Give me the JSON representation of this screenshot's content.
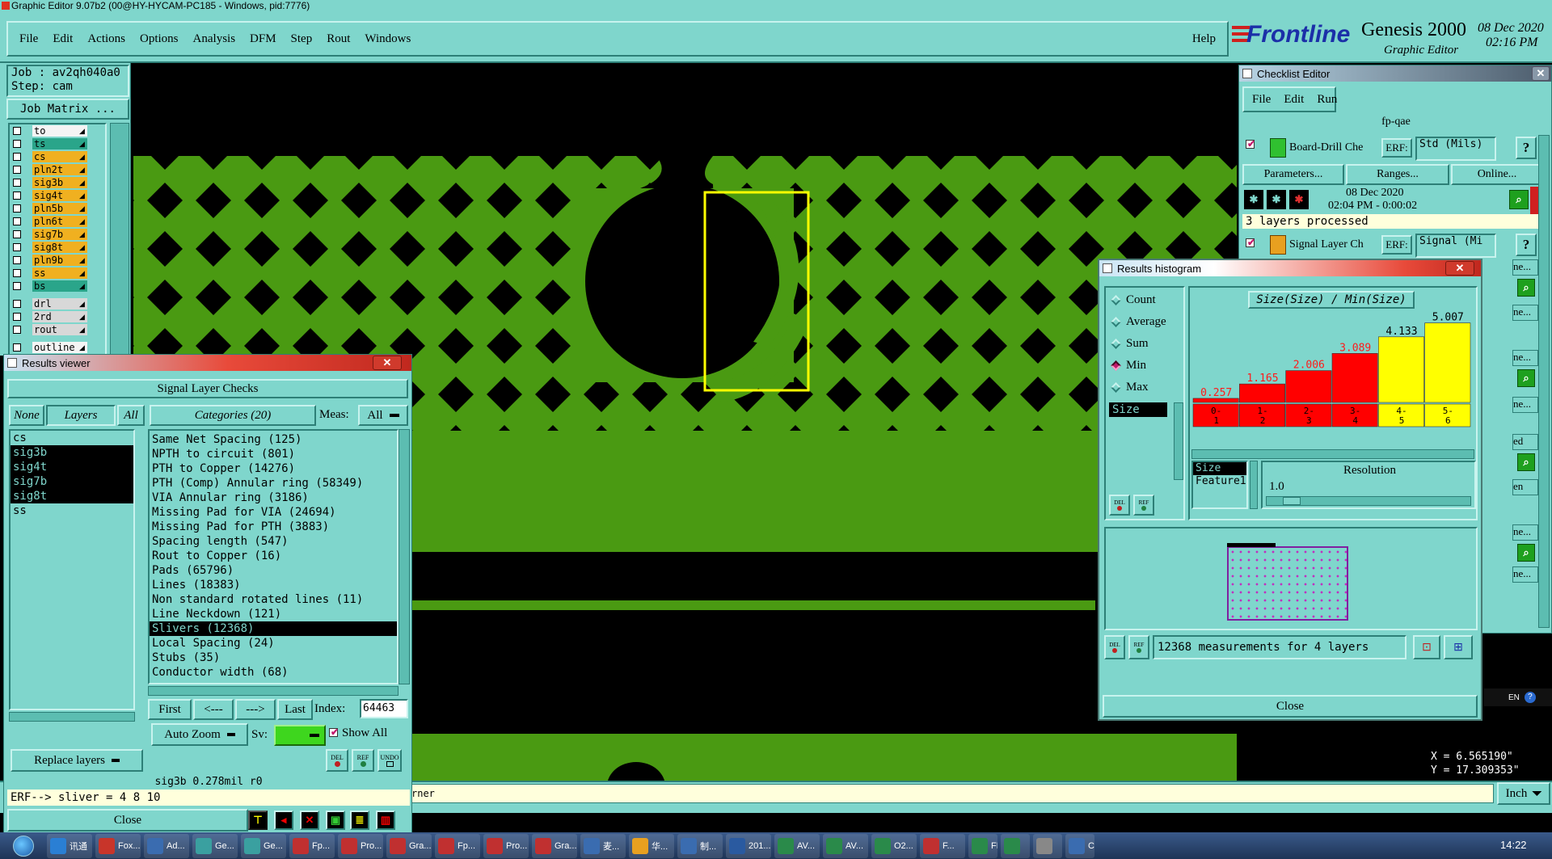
{
  "window_title": "Graphic Editor 9.07b2 (00@HY-HYCAM-PC185 - Windows, pid:7776)",
  "menu": {
    "items": [
      "File",
      "Edit",
      "Actions",
      "Options",
      "Analysis",
      "DFM",
      "Step",
      "Rout",
      "Windows"
    ],
    "help": "Help"
  },
  "brand": {
    "logo": "Frontline",
    "product": "Genesis 2000",
    "subtitle": "Graphic Editor",
    "date": "08 Dec 2020",
    "time": "02:16 PM"
  },
  "job": {
    "job_label": "Job : av2qh040a0",
    "step_label": "Step: cam",
    "matrix_button": "Job Matrix ..."
  },
  "layers": [
    {
      "name": "to",
      "color": "#f4f4f4"
    },
    {
      "name": "ts",
      "color": "#2aa58a"
    },
    {
      "name": "cs",
      "color": "#f0b020"
    },
    {
      "name": "pln2t",
      "color": "#f0b020"
    },
    {
      "name": "sig3b",
      "color": "#f0b020"
    },
    {
      "name": "sig4t",
      "color": "#f0b020"
    },
    {
      "name": "pln5b",
      "color": "#f0b020"
    },
    {
      "name": "pln6t",
      "color": "#f0b020"
    },
    {
      "name": "sig7b",
      "color": "#f0b020"
    },
    {
      "name": "sig8t",
      "color": "#f0b020"
    },
    {
      "name": "pln9b",
      "color": "#f0b020"
    },
    {
      "name": "ss",
      "color": "#f0b020"
    },
    {
      "name": "bs",
      "color": "#2aa58a"
    },
    {
      "name": "drl",
      "color": "#d8d8d8"
    },
    {
      "name": "2rd",
      "color": "#d8d8d8"
    },
    {
      "name": "rout",
      "color": "#d8d8d8"
    },
    {
      "name": "outline",
      "color": "#f4f4f4"
    }
  ],
  "results_viewer": {
    "title": "Results viewer",
    "header": "Signal Layer Checks",
    "btn_none": "None",
    "btn_layers": "Layers",
    "btn_all": "All",
    "categories_label": "Categories (20)",
    "meas_label": "Meas:",
    "meas_value": "All",
    "layer_list": [
      {
        "name": "cs",
        "sel": false
      },
      {
        "name": "sig3b",
        "sel": true
      },
      {
        "name": "sig4t",
        "sel": true
      },
      {
        "name": "sig7b",
        "sel": true
      },
      {
        "name": "sig8t",
        "sel": true
      },
      {
        "name": "ss",
        "sel": false
      }
    ],
    "categories": [
      {
        "text": "Same Net Spacing (125)",
        "sel": false
      },
      {
        "text": "NPTH to circuit (801)",
        "sel": false
      },
      {
        "text": "PTH to Copper (14276)",
        "sel": false
      },
      {
        "text": "PTH (Comp) Annular ring (58349)",
        "sel": false
      },
      {
        "text": "VIA Annular ring (3186)",
        "sel": false
      },
      {
        "text": "Missing Pad for VIA (24694)",
        "sel": false
      },
      {
        "text": "Missing Pad for PTH (3883)",
        "sel": false
      },
      {
        "text": "Spacing length (547)",
        "sel": false
      },
      {
        "text": "Rout to Copper (16)",
        "sel": false
      },
      {
        "text": "Pads (65796)",
        "sel": false
      },
      {
        "text": "Lines (18383)",
        "sel": false
      },
      {
        "text": "Non standard rotated lines (11)",
        "sel": false
      },
      {
        "text": "Line Neckdown (121)",
        "sel": false
      },
      {
        "text": "Slivers (12368)",
        "sel": true
      },
      {
        "text": "Local Spacing (24)",
        "sel": false
      },
      {
        "text": "Stubs (35)",
        "sel": false
      },
      {
        "text": "Conductor width (68)",
        "sel": false
      }
    ],
    "nav": {
      "first": "First",
      "prev": "<---",
      "next": "--->",
      "last": "Last",
      "index_label": "Index:",
      "index_value": "64463"
    },
    "auto_zoom": "Auto Zoom",
    "sv_label": "Sv:",
    "show_all": "Show All",
    "replace_layers": "Replace layers",
    "del": "DEL",
    "ref": "REF",
    "undo": "UNDO",
    "status": "sig3b 0.278mil  r0",
    "erf": "ERF--> sliver = 4 8 10",
    "close": "Close"
  },
  "checklist": {
    "title": "Checklist Editor",
    "menu": [
      "File",
      "Edit",
      "Run"
    ],
    "name": "fp-qae",
    "check1": {
      "name": "Board-Drill Che",
      "erf_label": "ERF:",
      "erf_value": "Std (Mils)",
      "parameters": "Parameters...",
      "ranges": "Ranges...",
      "online": "Online...",
      "date": "08 Dec 2020",
      "time": "02:04 PM - 0:00:02",
      "status": "3 layers processed"
    },
    "check2": {
      "name": "Signal Layer Ch",
      "erf_label": "ERF:",
      "erf_value": "Signal (Mi"
    },
    "q": "?",
    "right_labels": [
      "ne...",
      "ne...",
      "ne...",
      "ne...",
      "ed",
      "en",
      "ne...",
      "ne..."
    ]
  },
  "histogram": {
    "title": "Results histogram",
    "modes": [
      {
        "label": "Count",
        "on": false
      },
      {
        "label": "Average",
        "on": false
      },
      {
        "label": "Sum",
        "on": false
      },
      {
        "label": "Min",
        "on": true
      },
      {
        "label": "Max",
        "on": false
      }
    ],
    "size_item": "Size",
    "chart_title": "Size(Size) / Min(Size)",
    "attr_list": [
      {
        "text": "Size",
        "sel": true
      },
      {
        "text": "Feature1",
        "sel": false
      }
    ],
    "resolution_label": "Resolution",
    "resolution_value": "1.0",
    "measurements": "12368 measurements for 4 layers",
    "close": "Close"
  },
  "chart_data": {
    "type": "bar",
    "title": "Size(Size) / Min(Size)",
    "categories": [
      "0-1",
      "1-2",
      "2-3",
      "3-4",
      "4-5",
      "5-6"
    ],
    "category_top": [
      "0-",
      "1-",
      "2-",
      "3-",
      "4-",
      "5-"
    ],
    "category_bottom": [
      "1",
      "2",
      "3",
      "4",
      "5",
      "6"
    ],
    "values": [
      0.257,
      1.165,
      2.006,
      3.089,
      4.133,
      5.007
    ],
    "labels": [
      "0.257",
      "1.165",
      "2.006",
      "3.089",
      "4.133",
      "5.007"
    ],
    "colors": [
      "#ff0000",
      "#ff0000",
      "#ff0000",
      "#ff0000",
      "#ffff00",
      "#ffff00"
    ],
    "label_colors": [
      "#ff1a1a",
      "#ff1a1a",
      "#ff1a1a",
      "#ff1a1a",
      "#000000",
      "#000000"
    ],
    "ylim": [
      0,
      5.6
    ]
  },
  "coords": {
    "x": "X =  6.565190\"",
    "y": "Y = 17.309353\""
  },
  "bottom_bar": {
    "message": "rner",
    "unit": "Inch"
  },
  "tray": {
    "lang": "EN",
    "clock": "14:22"
  },
  "taskbar": [
    {
      "label": "讯通",
      "color": "#2a7fd4"
    },
    {
      "label": "Fox...",
      "color": "#c8352a"
    },
    {
      "label": "Ad...",
      "color": "#3a6cb0"
    },
    {
      "label": "Ge...",
      "color": "#3aa0a0"
    },
    {
      "label": "Ge...",
      "color": "#3aa0a0"
    },
    {
      "label": "Fp...",
      "color": "#c03030"
    },
    {
      "label": "Pro...",
      "color": "#c03030"
    },
    {
      "label": "Gra...",
      "color": "#c03030"
    },
    {
      "label": "Fp...",
      "color": "#c03030"
    },
    {
      "label": "Pro...",
      "color": "#c03030"
    },
    {
      "label": "Gra...",
      "color": "#c03030"
    },
    {
      "label": "麦...",
      "color": "#3a6cb0"
    },
    {
      "label": "华...",
      "color": "#e8a020"
    },
    {
      "label": "制...",
      "color": "#3a6cb0"
    },
    {
      "label": "201...",
      "color": "#2a5aa0"
    },
    {
      "label": "AV...",
      "color": "#2a8a4a"
    },
    {
      "label": "AV...",
      "color": "#2a8a4a"
    },
    {
      "label": "O2...",
      "color": "#2a8a4a"
    },
    {
      "label": "F...",
      "color": "#c03030"
    },
    {
      "label": "FD...",
      "color": "#2a8a4a"
    },
    {
      "label": "",
      "color": "#2a8a4a"
    },
    {
      "label": "",
      "color": "#888888"
    },
    {
      "label": "CA...",
      "color": "#3a6cb0"
    }
  ]
}
